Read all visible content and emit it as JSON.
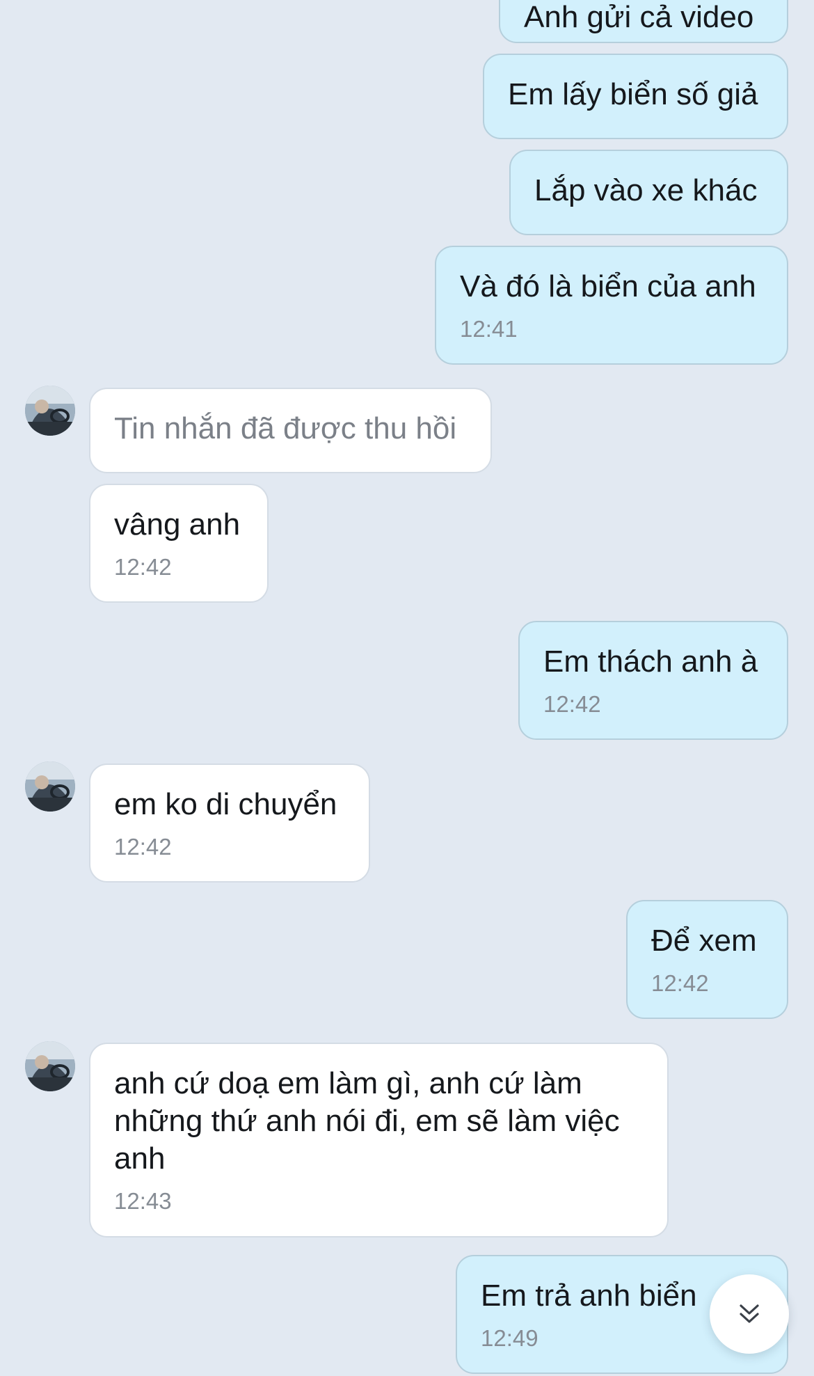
{
  "messages": [
    {
      "id": "m1",
      "direction": "out",
      "text": "Anh gửi cả video",
      "time": ""
    },
    {
      "id": "m2",
      "direction": "out",
      "text": "Em lấy biển số giả",
      "time": ""
    },
    {
      "id": "m3",
      "direction": "out",
      "text": "Lắp vào xe khác",
      "time": ""
    },
    {
      "id": "m4",
      "direction": "out",
      "text": "Và đó là biển của anh",
      "time": "12:41"
    },
    {
      "id": "m5",
      "direction": "in",
      "text": "Tin nhắn đã được thu hồi",
      "time": "",
      "recalled": true
    },
    {
      "id": "m6",
      "direction": "in",
      "text": "vâng anh",
      "time": "12:42"
    },
    {
      "id": "m7",
      "direction": "out",
      "text": "Em thách anh à",
      "time": "12:42"
    },
    {
      "id": "m8",
      "direction": "in",
      "text": "em ko di chuyển",
      "time": "12:42"
    },
    {
      "id": "m9",
      "direction": "out",
      "text": "Để xem",
      "time": "12:42"
    },
    {
      "id": "m10",
      "direction": "in",
      "text": "anh cứ doạ em làm gì, anh cứ làm\nnhững thứ anh nói đi, em sẽ làm việc\nanh",
      "time": "12:43"
    },
    {
      "id": "m11",
      "direction": "out",
      "text": "Em trả anh biển",
      "time": "12:49"
    }
  ],
  "scroll_down_button": {
    "icon": "double-chevron-down-icon"
  },
  "colors": {
    "background": "#e2e9f2",
    "outgoing_bubble": "#d2f0fc",
    "incoming_bubble": "#ffffff",
    "timestamp": "#868c94",
    "recalled_text": "#7b8088"
  }
}
